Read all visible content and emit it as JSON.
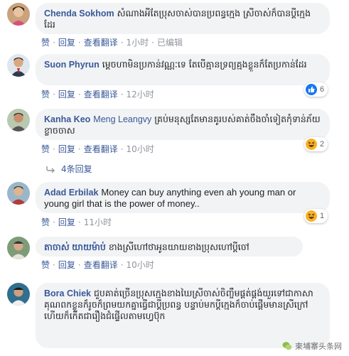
{
  "actions": {
    "like": "赞",
    "reply": "回复",
    "see_translation": "查看翻译",
    "edited": "已编辑",
    "separator": "·"
  },
  "comments": [
    {
      "author": "Chenda Sokhom",
      "text": "សំណាងអីតែប្រុសចាស់បានប្រពន្ធក្មេង ស្រីចាស់ក៏បានប្ដីក្មេងដែរ",
      "time": "1小时",
      "has_translation": true,
      "edited": true
    },
    {
      "author": "Suon Phyrun",
      "text": "ម្ដេចហាមិនប្រកាន់វណ្ណៈទេ តែបើគ្មានទ្រព្យគ្មងខ្លួនក៏តែប្រកាន់ដែរ",
      "time": "12小时",
      "has_translation": true,
      "reaction": {
        "icon": "like-icon",
        "count": "6",
        "color": "#1877f2"
      }
    },
    {
      "author": "Kanha Keo",
      "mention": "Meng Leangvy",
      "text": "គ្រប់មនុស្សតែមានគូរបស់គាត់ចឹងចាំទៀតកុំទាន់ភ័យខ្លាចចាស",
      "time": "10小时",
      "has_translation": true,
      "reaction": {
        "icon": "haha-icon",
        "count": "2",
        "color": "#f7b125"
      }
    },
    {
      "author": "Adad Erbilak",
      "text": "Money can buy anything even ah young man or young girl that is the power of money..",
      "time": "11小时",
      "has_translation": false,
      "reaction": {
        "icon": "haha-icon",
        "count": "1",
        "color": "#f7b125"
      }
    },
    {
      "author": "តាចាស់ យាយម៉ាប់",
      "text": "ខាងស្រីហៅថាអូនយាយខាងប្រុសហៅប្ដីចៅ",
      "time": "10小时",
      "has_translation": true
    },
    {
      "author": "Bora Chiek",
      "text": "ជួបគាត់ច្រើនប្រុសក្មេងខាងឃៃស្រីចាស់ចិញ្ចឹមផ្គត់ផ្គង់យួរទៅជាកាសាគុណពកខ្លួនក៏រូចក៏ព្រមយកគ្នាធ្វើជាប្ដីប្រពន្ធ បន្ទាប់មកប្ដីក្មេងក៏ចាប់ផ្ដើមមានស្រីក្រៅហើយក៏កើតជារឿងជំផ្ទើលតាមហ្វេប៊ុក",
      "time": "",
      "has_translation": false
    }
  ],
  "replies_link": "4条回复",
  "watermark": "柬埔寨头条网"
}
